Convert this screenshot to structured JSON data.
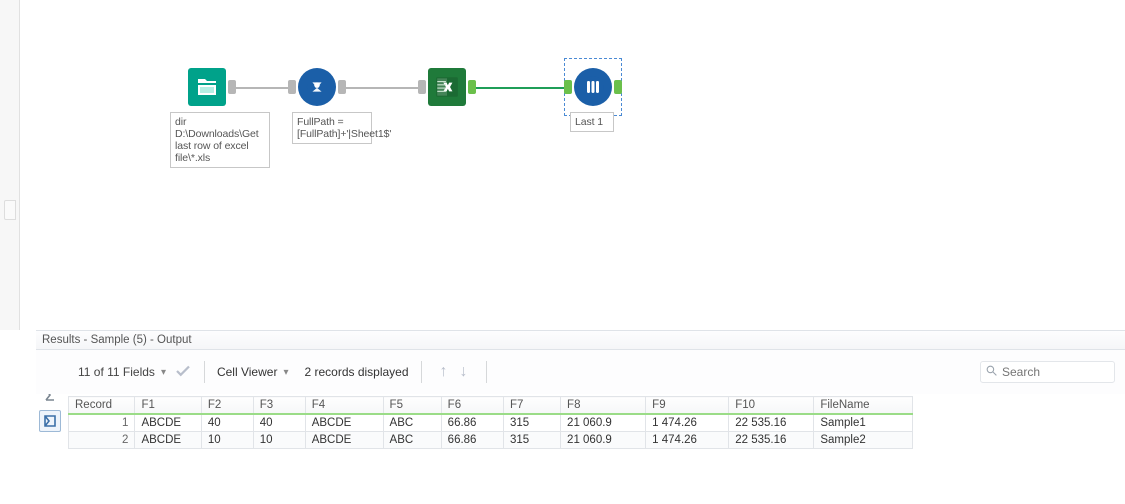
{
  "canvas": {
    "nodes": {
      "directory": {
        "label": "dir D:\\Downloads\\Get last row of excel file\\*.xls",
        "bg": "#009688",
        "anchor_out": "#b6b6b6"
      },
      "formula": {
        "label": "FullPath = [FullPath]+'|Sheet1$'",
        "bg": "#1757a6",
        "anchor_in": "#b6b6b6",
        "anchor_out": "#b6b6b6"
      },
      "dynamic_input": {
        "label": "",
        "bg": "#1b7a37",
        "anchor_in": "#b6b6b6",
        "anchor_out": "#6bc04b"
      },
      "sample": {
        "label": "Last 1",
        "bg": "#1757a6",
        "anchor_in": "#6bc04b",
        "anchor_out": "#6bc04b",
        "selected": true
      }
    }
  },
  "results": {
    "title": "Results - Sample (5) - Output",
    "fields_summary": "11 of 11 Fields",
    "cell_viewer_label": "Cell Viewer",
    "records_displayed": "2 records displayed",
    "search_placeholder": "Search",
    "columns": [
      "Record",
      "F1",
      "F2",
      "F3",
      "F4",
      "F5",
      "F6",
      "F7",
      "F8",
      "F9",
      "F10",
      "FileName"
    ],
    "rows": [
      {
        "Record": "1",
        "F1": "ABCDE",
        "F2": "40",
        "F3": "40",
        "F4": "ABCDE",
        "F5": "ABC",
        "F6": "66.86",
        "F7": "315",
        "F8": "21 060.9",
        "F9": "1 474.26",
        "F10": "22 535.16",
        "FileName": "Sample1"
      },
      {
        "Record": "2",
        "F1": "ABCDE",
        "F2": "10",
        "F3": "10",
        "F4": "ABCDE",
        "F5": "ABC",
        "F6": "66.86",
        "F7": "315",
        "F8": "21 060.9",
        "F9": "1 474.26",
        "F10": "22 535.16",
        "FileName": "Sample2"
      }
    ]
  },
  "col_widths": {
    "Record": 64,
    "F1": 64,
    "F2": 50,
    "F3": 50,
    "F4": 75,
    "F5": 56,
    "F6": 60,
    "F7": 55,
    "F8": 82,
    "F9": 80,
    "F10": 82,
    "FileName": 95
  }
}
